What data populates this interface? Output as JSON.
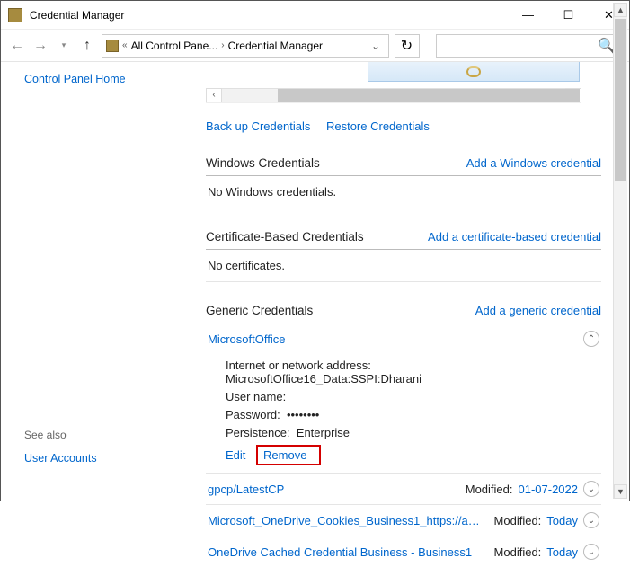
{
  "window": {
    "title": "Credential Manager"
  },
  "nav": {
    "breadcrumb_prefix": "«",
    "breadcrumb_1": "All Control Pane...",
    "breadcrumb_2": "Credential Manager"
  },
  "left": {
    "home": "Control Panel Home",
    "seealso_hd": "See also",
    "seealso_1": "User Accounts"
  },
  "links": {
    "backup": "Back up Credentials",
    "restore": "Restore Credentials"
  },
  "section_win": {
    "title": "Windows Credentials",
    "add": "Add a Windows credential",
    "empty": "No Windows credentials."
  },
  "section_cert": {
    "title": "Certificate-Based Credentials",
    "add": "Add a certificate-based credential",
    "empty": "No certificates."
  },
  "section_gen": {
    "title": "Generic Credentials",
    "add": "Add a generic credential"
  },
  "cred0": {
    "name": "MicrosoftOffice",
    "f1_label": "Internet or network address:",
    "f1_value": "MicrosoftOffice16_Data:SSPI:Dharani",
    "f2_label": "User name:",
    "f3_label": "Password:",
    "f3_value": "••••••••",
    "f4_label": "Persistence:",
    "f4_value": "Enterprise",
    "edit": "Edit",
    "remove": "Remove"
  },
  "cred1": {
    "name": "gpcp/LatestCP",
    "mod_label": "Modified:",
    "mod_value": "01-07-2022"
  },
  "cred2": {
    "name": "Microsoft_OneDrive_Cookies_Business1_https://amne...",
    "mod_label": "Modified:",
    "mod_value": "Today"
  },
  "cred3": {
    "name": "OneDrive Cached Credential Business - Business1",
    "mod_label": "Modified:",
    "mod_value": "Today"
  }
}
